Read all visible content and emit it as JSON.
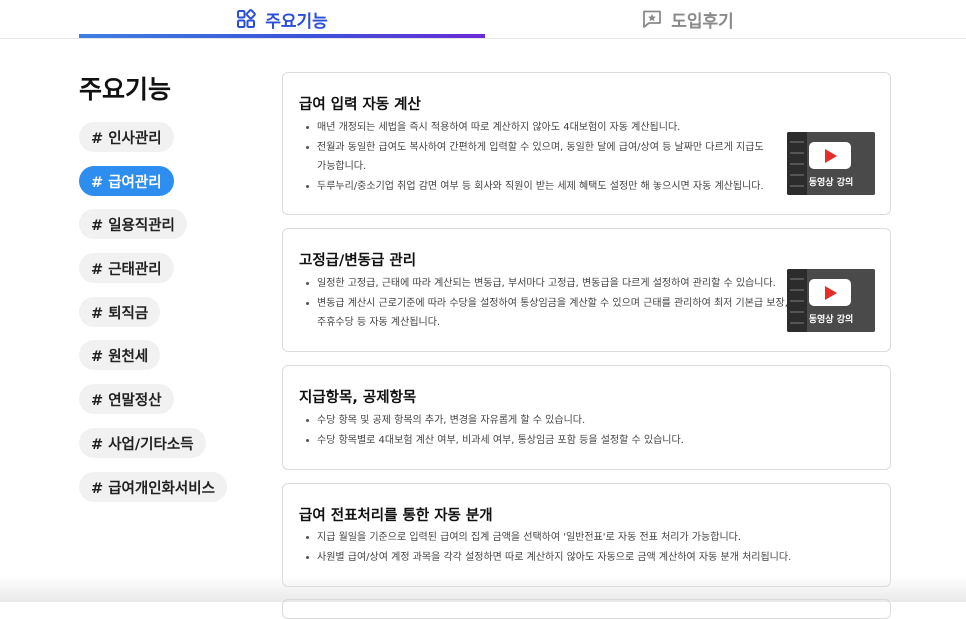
{
  "tabs": [
    {
      "label": "주요기능",
      "icon": "grid-icon",
      "active": true,
      "color": "#2b4fd8"
    },
    {
      "label": "도입후기",
      "icon": "star-review-icon",
      "active": false,
      "color": "#8a8a8a"
    }
  ],
  "sidebar": {
    "title": "주요기능",
    "items": [
      {
        "label": "# 인사관리"
      },
      {
        "label": "# 급여관리",
        "active": true
      },
      {
        "label": "# 일용직관리"
      },
      {
        "label": "# 근태관리"
      },
      {
        "label": "# 퇴직금"
      },
      {
        "label": "# 원천세"
      },
      {
        "label": "# 연말정산"
      },
      {
        "label": "# 사업/기타소득"
      },
      {
        "label": "# 급여개인화서비스"
      }
    ],
    "active_color": "#2e8ef0"
  },
  "cards": [
    {
      "title": "급여 입력 자동 계산",
      "bullets": [
        "매년 개정되는 세법을 즉시 적용하여 따로 계산하지 않아도 4대보험이 자동 계산됩니다.",
        "전월과 동일한 급여도 복사하여 간편하게 입력할 수 있으며, 동일한 달에 급여/상여 등 날짜만 다르게 지급도",
        "가능합니다.",
        "두루누리/중소기업 취업 감면 여부 등 회사와 직원이 받는 세제 혜택도 설정만 해 놓으시면 자동 계산됩니다."
      ],
      "video_label": "동영상 강의"
    },
    {
      "title": "고정급/변동급 관리",
      "bullets": [
        "일정한 고정급, 근태에 따라 계산되는 변동급, 부서마다 고정급, 변동급을 다르게 설정하여 관리할 수 있습니다.",
        "변동급 계산시 근로기준에 따라 수당을 설정하여 통상임금을 계산할 수 있으며 근태를 관리하여 최저 기본급 보장,",
        "주휴수당 등 자동 계산됩니다."
      ],
      "video_label": "동영상 강의"
    },
    {
      "title": "지급항목, 공제항목",
      "bullets": [
        "수당 항목 및 공제 항목의 추가, 변경을 자유롭게 할 수 있습니다.",
        "수당 항목별로 4대보험 계산 여부, 비과세 여부, 통상임금 포함 등을 설정할 수 있습니다."
      ]
    },
    {
      "title": "급여 전표처리를 통한 자동 분개",
      "bullets": [
        "지급 월일을 기준으로 입력된 급여의 집계 금액을 선택하여 '일반전표'로 자동 전표 처리가 가능합니다.",
        "사원별 급여/상여 계정 과목을 각각 설정하면 따로 계산하지 않아도 자동으로 금액 계산하여 자동 분개 처리됩니다."
      ]
    }
  ]
}
